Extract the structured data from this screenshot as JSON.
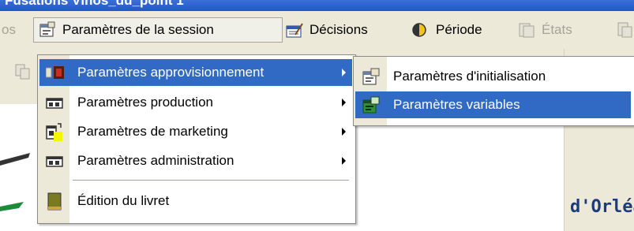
{
  "window": {
    "title_fragment": "Fusations Vlnos_du_point 1"
  },
  "menubar": {
    "items": [
      {
        "label": "os",
        "icon": "partial",
        "enabled": false
      },
      {
        "label": "Paramètres de la session",
        "icon": "session-params-icon",
        "enabled": true,
        "active": true
      },
      {
        "label": "Décisions",
        "icon": "decisions-icon",
        "enabled": true
      },
      {
        "label": "Période",
        "icon": "period-icon",
        "enabled": true
      },
      {
        "label": "États",
        "icon": "states-icon",
        "enabled": false
      }
    ]
  },
  "session_menu": {
    "items": [
      {
        "label": "Paramètres approvisionnement",
        "icon": "supply-icon",
        "submenu": true,
        "highlighted": true
      },
      {
        "label": "Paramètres production",
        "icon": "production-icon",
        "submenu": true
      },
      {
        "label": "Paramètres de marketing",
        "icon": "marketing-icon",
        "submenu": true
      },
      {
        "label": "Paramètres administration",
        "icon": "administration-icon",
        "submenu": true
      },
      {
        "label": "Édition du livret",
        "icon": "booklet-icon",
        "submenu": false
      }
    ]
  },
  "supply_submenu": {
    "items": [
      {
        "label": "Paramètres d'initialisation",
        "icon": "init-params-icon"
      },
      {
        "label": "Paramètres variables",
        "icon": "variable-params-icon",
        "highlighted": true
      }
    ]
  },
  "background": {
    "banner_text": "d'Orléa"
  },
  "colors": {
    "highlight": "#316ac5",
    "menubar": "#ece9d8",
    "title": "#2457c6"
  }
}
